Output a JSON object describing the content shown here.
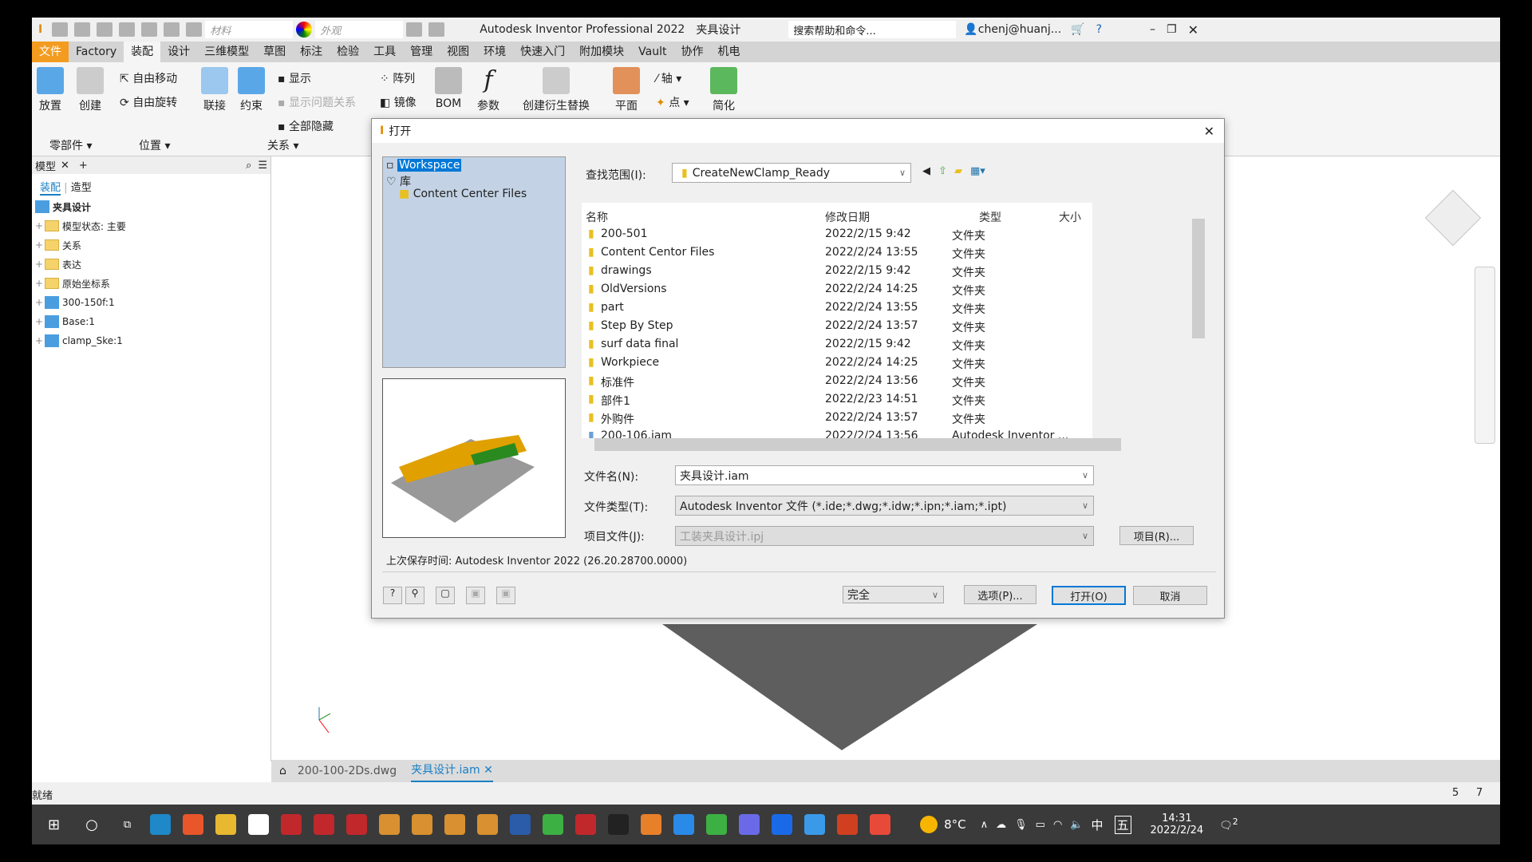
{
  "app": {
    "title": "Autodesk Inventor Professional 2022",
    "doc": "夹具设计",
    "search_placeholder": "搜索帮助和命令...",
    "user": "chenj@huanj...",
    "material": "材料",
    "appearance": "外观"
  },
  "menu": [
    "文件",
    "Factory",
    "装配",
    "设计",
    "三维模型",
    "草图",
    "标注",
    "检验",
    "工具",
    "管理",
    "视图",
    "环境",
    "快速入门",
    "附加模块",
    "Vault",
    "协作",
    "机电"
  ],
  "ribbon": {
    "place": "放置",
    "create": "创建",
    "free_move": "自由移动",
    "free_rotate": "自由旋转",
    "joint": "联接",
    "constrain": "约束",
    "show": "显示",
    "show_sick": "显示问题关系",
    "hide_all": "全部隐藏",
    "pattern": "阵列",
    "mirror": "镜像",
    "bom": "BOM",
    "params": "参数",
    "derive": "创建衍生替换",
    "plane": "平面",
    "axis": "轴",
    "point": "点",
    "simplify": "简化",
    "panels": [
      "零部件",
      "位置",
      "关系"
    ]
  },
  "browser": {
    "tab": "模型",
    "subtabs": [
      "装配",
      "造型"
    ],
    "root": "夹具设计",
    "items": [
      "模型状态: 主要",
      "关系",
      "表达",
      "原始坐标系",
      "300-150f:1",
      "Base:1",
      "clamp_Ske:1"
    ]
  },
  "doc_tabs": [
    "200-100-2Ds.dwg",
    "夹具设计.iam"
  ],
  "status": {
    "text": "就绪",
    "n1": "5",
    "n2": "7"
  },
  "dialog": {
    "title": "打开",
    "nav": [
      "Workspace",
      "库",
      "Content Center Files"
    ],
    "look_in_label": "查找范围(I):",
    "look_in": "CreateNewClamp_Ready",
    "columns": [
      "名称",
      "修改日期",
      "类型",
      "大小"
    ],
    "files": [
      {
        "name": "200-501",
        "date": "2022/2/15 9:42",
        "type": "文件夹"
      },
      {
        "name": "Content Centor Files",
        "date": "2022/2/24 13:55",
        "type": "文件夹"
      },
      {
        "name": "drawings",
        "date": "2022/2/15 9:42",
        "type": "文件夹"
      },
      {
        "name": "OldVersions",
        "date": "2022/2/24 14:25",
        "type": "文件夹"
      },
      {
        "name": "part",
        "date": "2022/2/24 13:55",
        "type": "文件夹"
      },
      {
        "name": "Step By Step",
        "date": "2022/2/24 13:57",
        "type": "文件夹"
      },
      {
        "name": "surf data final",
        "date": "2022/2/15 9:42",
        "type": "文件夹"
      },
      {
        "name": "Workpiece",
        "date": "2022/2/24 14:25",
        "type": "文件夹"
      },
      {
        "name": "标准件",
        "date": "2022/2/24 13:56",
        "type": "文件夹"
      },
      {
        "name": "部件1",
        "date": "2022/2/23 14:51",
        "type": "文件夹"
      },
      {
        "name": "外购件",
        "date": "2022/2/24 13:57",
        "type": "文件夹"
      },
      {
        "name": "200-106.iam",
        "date": "2022/2/24 13:56",
        "type": "Autodesk Inventor ..."
      }
    ],
    "filename_label": "文件名(N):",
    "filename": "夹具设计.iam",
    "filetype_label": "文件类型(T):",
    "filetype": "Autodesk Inventor 文件 (*.ide;*.dwg;*.idw;*.ipn;*.iam;*.ipt)",
    "project_label": "项目文件(J):",
    "project": "工装夹具设计.ipj",
    "project_btn": "项目(R)...",
    "last_saved": "上次保存时间: Autodesk Inventor 2022 (26.20.28700.0000)",
    "mode": "完全",
    "options": "选项(P)...",
    "open": "打开(O)",
    "cancel": "取消"
  },
  "taskbar": {
    "weather": "8°C",
    "ime1": "中",
    "ime2": "五",
    "time": "14:31",
    "date": "2022/2/24",
    "notif": "2"
  },
  "colors": {
    "accent": "#f39c20",
    "select": "#0078d7"
  }
}
